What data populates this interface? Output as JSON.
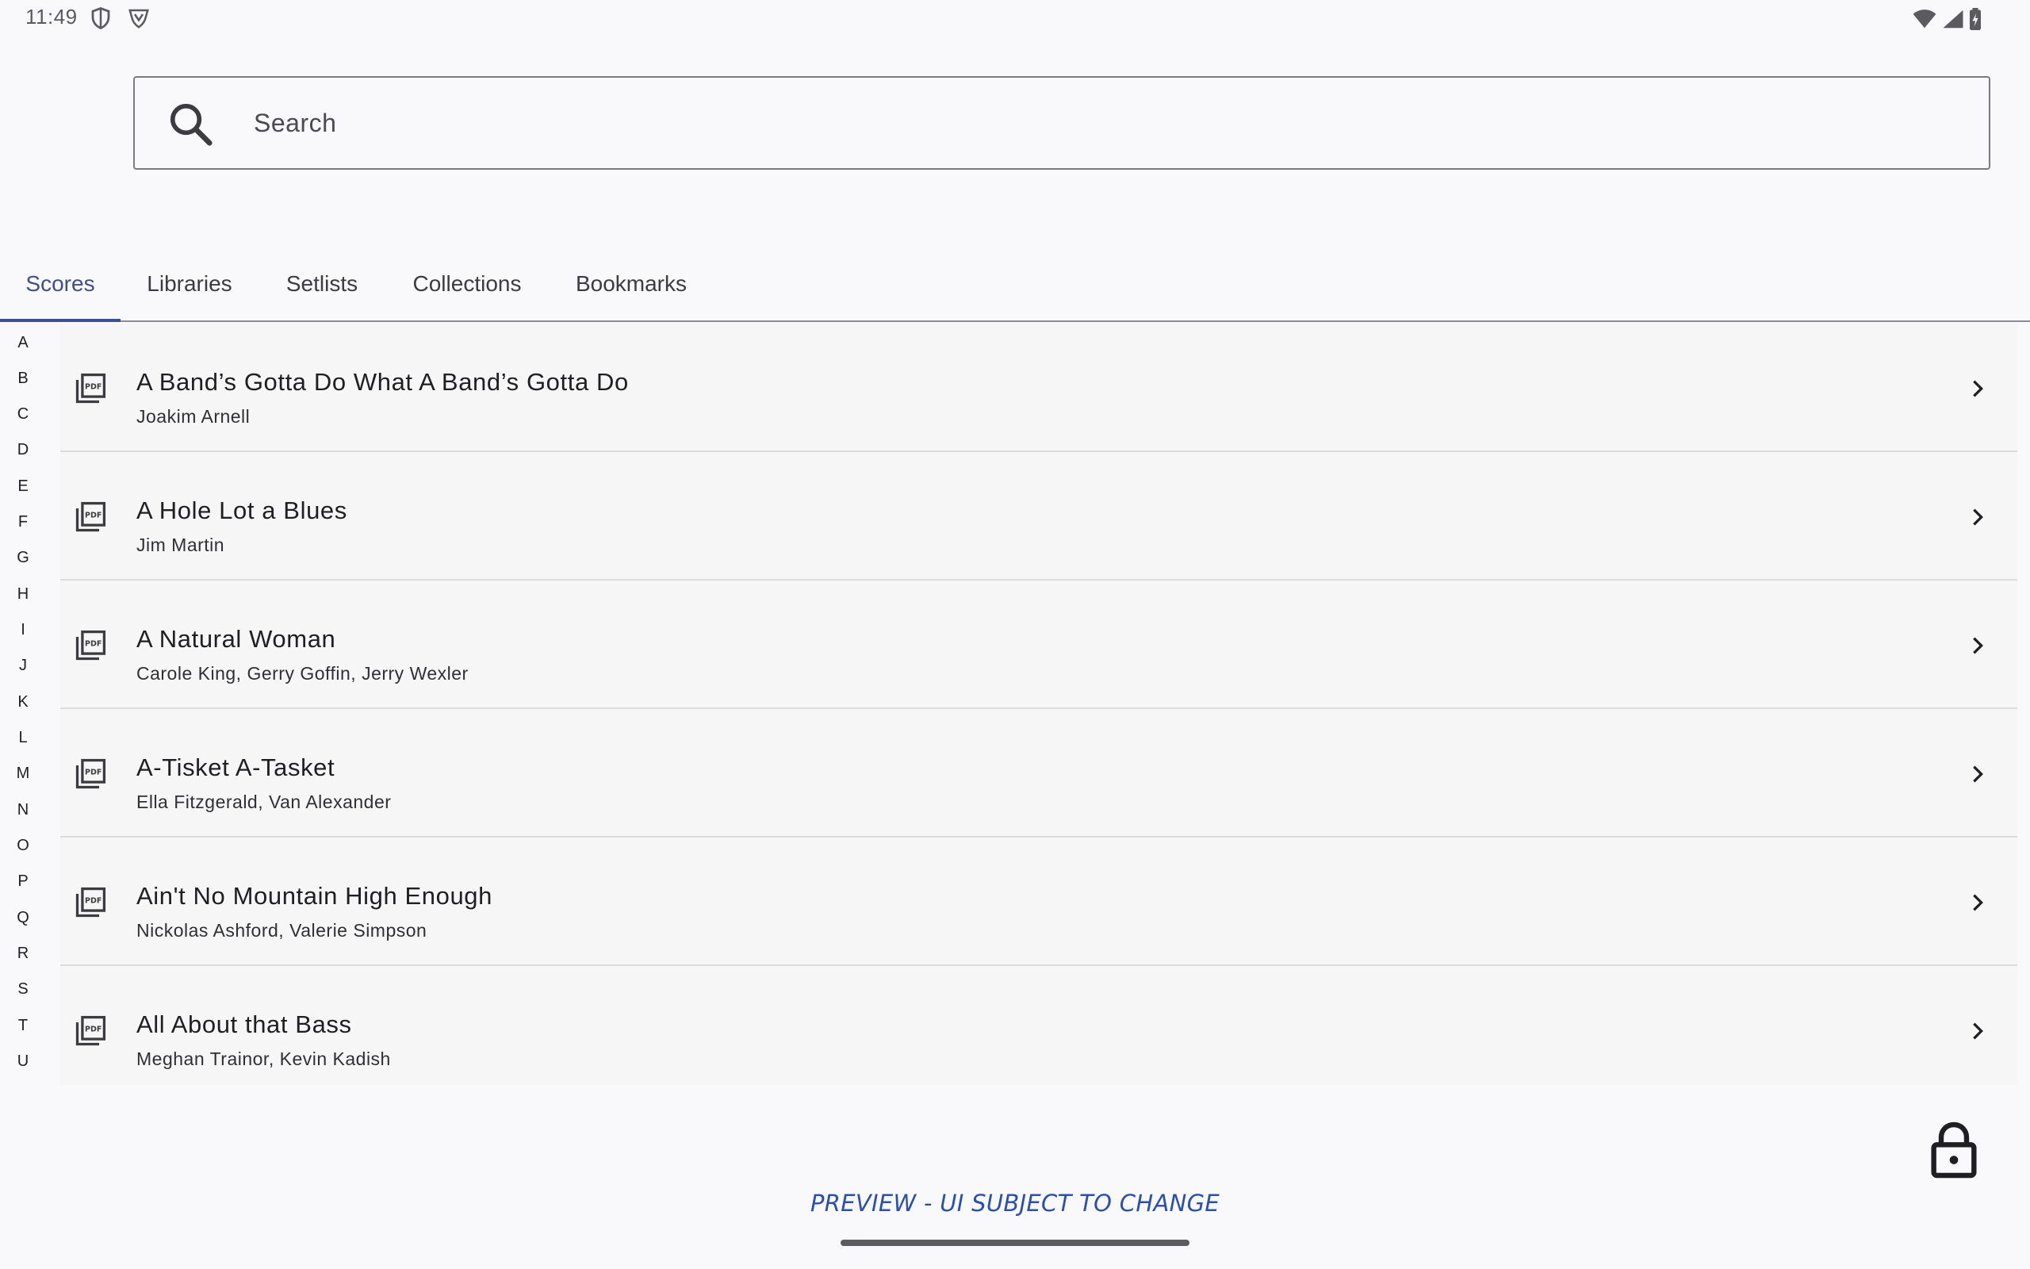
{
  "status_bar": {
    "time": "11:49"
  },
  "search": {
    "placeholder": "Search",
    "value": ""
  },
  "tabs": [
    {
      "label": "Scores",
      "active": true
    },
    {
      "label": "Libraries",
      "active": false
    },
    {
      "label": "Setlists",
      "active": false
    },
    {
      "label": "Collections",
      "active": false
    },
    {
      "label": "Bookmarks",
      "active": false
    }
  ],
  "alphabet": [
    "A",
    "B",
    "C",
    "D",
    "E",
    "F",
    "G",
    "H",
    "I",
    "J",
    "K",
    "L",
    "M",
    "N",
    "O",
    "P",
    "Q",
    "R",
    "S",
    "T",
    "U"
  ],
  "scores": [
    {
      "title": "A Band’s Gotta Do What A Band’s Gotta Do",
      "composer": "Joakim Arnell"
    },
    {
      "title": "A Hole Lot a Blues",
      "composer": "Jim Martin"
    },
    {
      "title": "A Natural Woman",
      "composer": "Carole King, Gerry Goffin, Jerry Wexler"
    },
    {
      "title": "A-Tisket A-Tasket",
      "composer": "Ella Fitzgerald, Van Alexander"
    },
    {
      "title": "Ain't No Mountain High Enough",
      "composer": "Nickolas Ashford, Valerie Simpson"
    },
    {
      "title": "All About that Bass",
      "composer": "Meghan Trainor, Kevin Kadish"
    }
  ],
  "preview_banner": "PREVIEW - UI SUBJECT TO CHANGE",
  "icons": {
    "search": "search-icon",
    "pdf": "pdf-file-icon",
    "chevron": "chevron-right-icon",
    "lock": "lock-icon"
  },
  "colors": {
    "accent": "#3d4f8f",
    "preview_text": "#2a4fb0",
    "background": "#f9f9fb",
    "list_background": "#f6f6f6"
  }
}
